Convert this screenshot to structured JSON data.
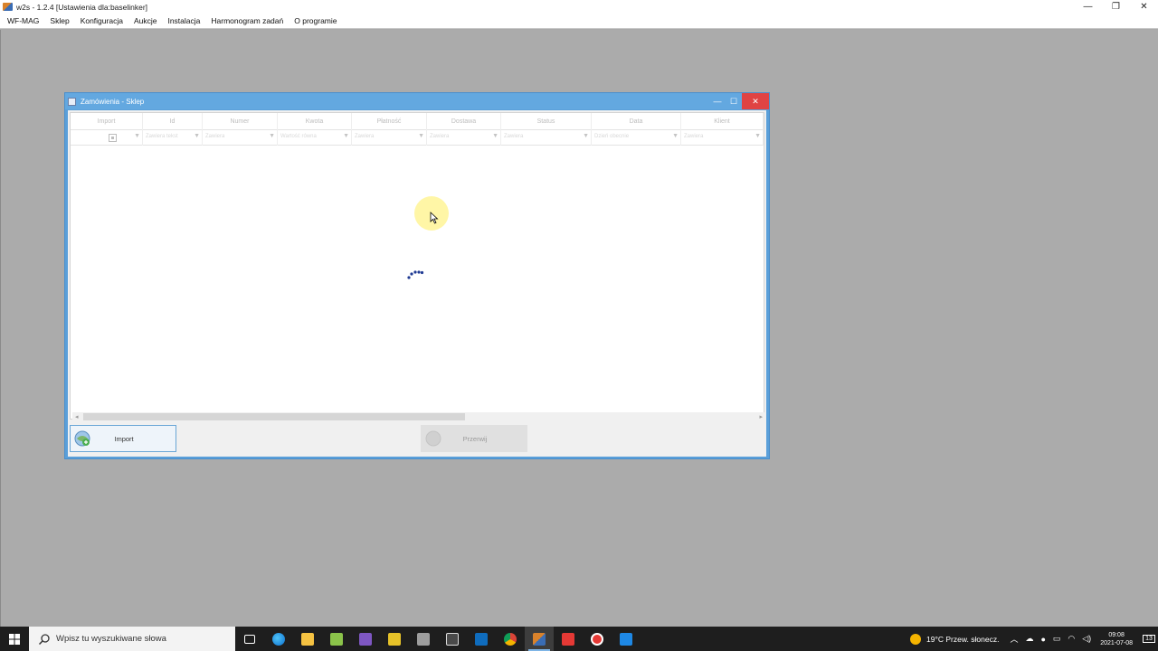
{
  "app": {
    "title": "w2s - 1.2.4 [Ustawienia dla:baselinker]",
    "controls": [
      "—",
      "❐",
      "✕"
    ]
  },
  "menu": [
    "WF-MAG",
    "Sklep",
    "Konfiguracja",
    "Aukcje",
    "Instalacja",
    "Harmonogram zadań",
    "O programie"
  ],
  "child": {
    "title": "Zamówienia - Sklep",
    "controls": [
      "—",
      "☐",
      "✕"
    ],
    "columns": [
      "Import",
      "Id",
      "Numer",
      "Kwota",
      "Płatność",
      "Dostawa",
      "Status",
      "Data",
      "Klient"
    ],
    "filters": [
      "",
      "Zawiera tekst",
      "Zawiera",
      "Wartość równa",
      "Zawiera",
      "Zawiera",
      "Zawiera",
      "Dzień obecnie",
      "Zawiera"
    ],
    "buttons": {
      "import": "Import",
      "przerwij": "Przerwij"
    }
  },
  "taskbar": {
    "search_placeholder": "Wpisz tu wyszukiwane słowa",
    "weather": "19°C  Przew. słonecz.",
    "time": "09:08",
    "date": "2021-07-08",
    "notifications": "13"
  }
}
